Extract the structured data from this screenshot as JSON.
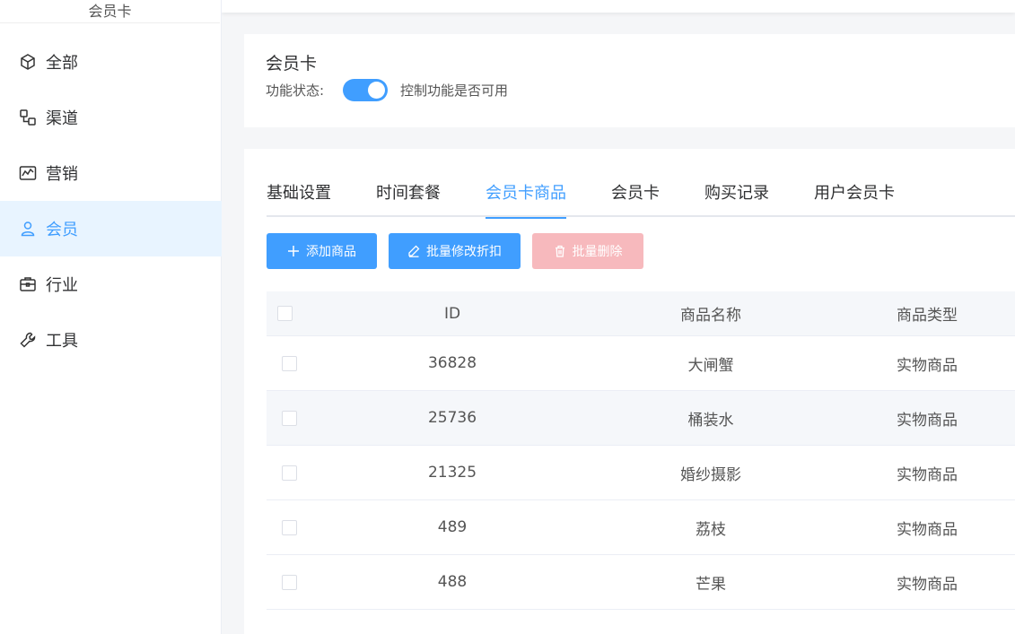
{
  "sidebar": {
    "title": "会员卡",
    "items": [
      {
        "label": "全部",
        "icon": "cube-icon",
        "active": false
      },
      {
        "label": "渠道",
        "icon": "channel-icon",
        "active": false
      },
      {
        "label": "营销",
        "icon": "chart-icon",
        "active": false
      },
      {
        "label": "会员",
        "icon": "user-icon",
        "active": true
      },
      {
        "label": "行业",
        "icon": "briefcase-icon",
        "active": false
      },
      {
        "label": "工具",
        "icon": "wrench-icon",
        "active": false
      }
    ]
  },
  "header": {
    "title": "会员卡",
    "status_label": "功能状态:",
    "status_enabled": true,
    "status_description": "控制功能是否可用"
  },
  "tabs": [
    {
      "label": "基础设置",
      "active": false
    },
    {
      "label": "时间套餐",
      "active": false
    },
    {
      "label": "会员卡商品",
      "active": true
    },
    {
      "label": "会员卡",
      "active": false
    },
    {
      "label": "购买记录",
      "active": false
    },
    {
      "label": "用户会员卡",
      "active": false
    }
  ],
  "toolbar": {
    "add_label": "添加商品",
    "batch_edit_label": "批量修改折扣",
    "batch_delete_label": "批量删除"
  },
  "table": {
    "columns": [
      "ID",
      "商品名称",
      "商品类型"
    ],
    "rows": [
      {
        "id": "36828",
        "name": "大闸蟹",
        "type": "实物商品"
      },
      {
        "id": "25736",
        "name": "桶装水",
        "type": "实物商品"
      },
      {
        "id": "21325",
        "name": "婚纱摄影",
        "type": "实物商品"
      },
      {
        "id": "489",
        "name": "荔枝",
        "type": "实物商品"
      },
      {
        "id": "488",
        "name": "芒果",
        "type": "实物商品"
      }
    ]
  },
  "colors": {
    "primary": "#409eff",
    "danger_disabled": "#f7b9bd",
    "active_bg": "#e8f4ff"
  }
}
